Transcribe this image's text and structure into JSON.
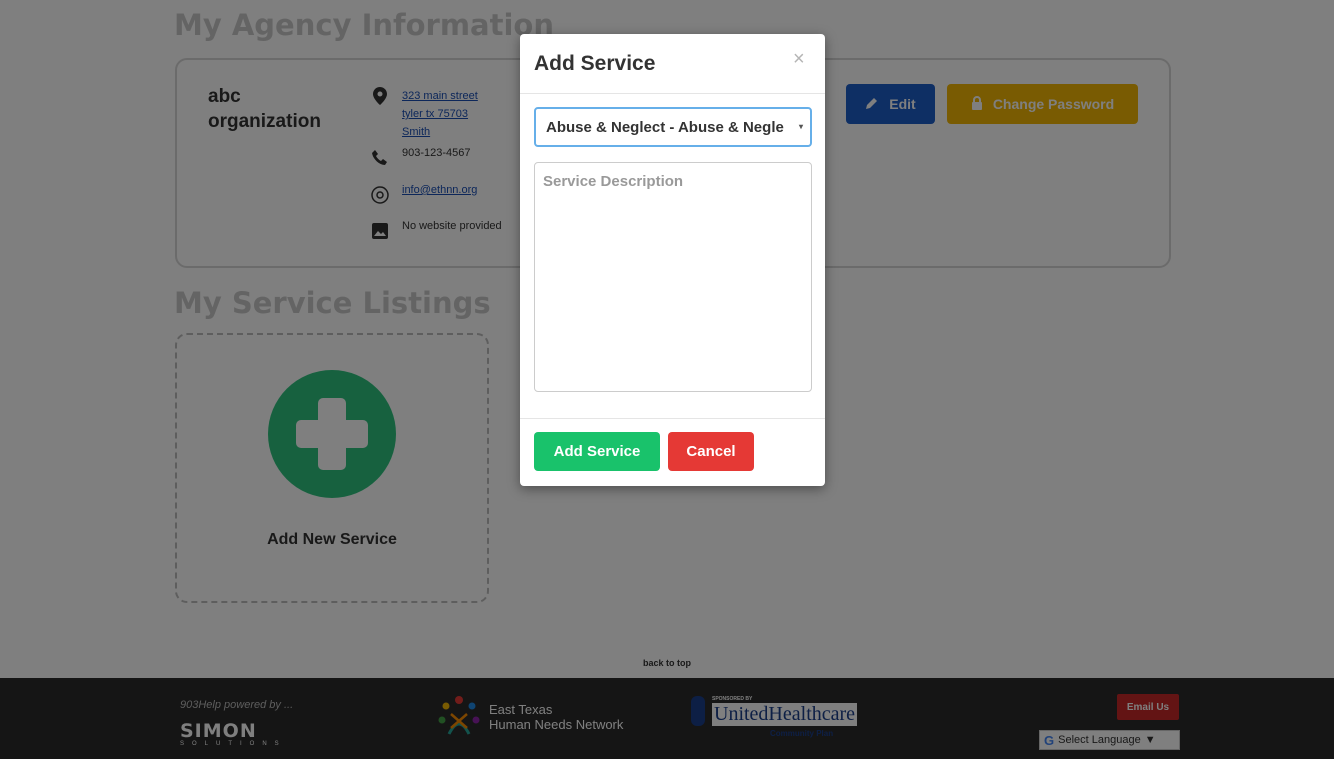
{
  "agency": {
    "heading": "My Agency Information",
    "org_name": "abc organization",
    "address_line1": "323 main street",
    "address_line2": "tyler tx 75703",
    "address_line3": "Smith",
    "phone": "903-123-4567",
    "email": "info@ethnn.org",
    "website": "No website provided",
    "edit_label": "Edit",
    "change_password_label": "Change Password"
  },
  "listings": {
    "heading": "My Service Listings",
    "add_new_label": "Add New Service"
  },
  "back_to_top": "back to top",
  "footer": {
    "powered_by": "903Help powered by ...",
    "simon_logo": "SIMON",
    "simon_sub": "SOLUTIONS",
    "ethnn_line1": "East Texas",
    "ethnn_line2": "Human Needs Network",
    "uhc_sponsored": "SPONSORED BY",
    "uhc_name": "UnitedHealthcare",
    "uhc_sub": "Community Plan",
    "email_us": "Email Us",
    "select_language": "Select Language",
    "google_g": "G",
    "language_caret": "▼"
  },
  "modal": {
    "title": "Add Service",
    "close_glyph": "×",
    "selected_service": "Abuse & Neglect - Abuse & Neglect",
    "select_caret": "▾",
    "description_placeholder": "Service Description",
    "add_button": "Add Service",
    "cancel_button": "Cancel"
  },
  "colors": {
    "accent_green": "#19c26b",
    "cancel_red": "#e53935",
    "edit_blue": "#1d5ec9",
    "password_yellow": "#f2b705",
    "focus_blue": "#66afe9"
  },
  "icons": {
    "address": "map-marker-icon",
    "phone": "phone-icon",
    "email": "at-sign-icon",
    "website": "broken-image-icon",
    "edit": "pencil-icon",
    "password": "lock-icon",
    "add": "plus-circle-icon",
    "close": "close-icon"
  }
}
